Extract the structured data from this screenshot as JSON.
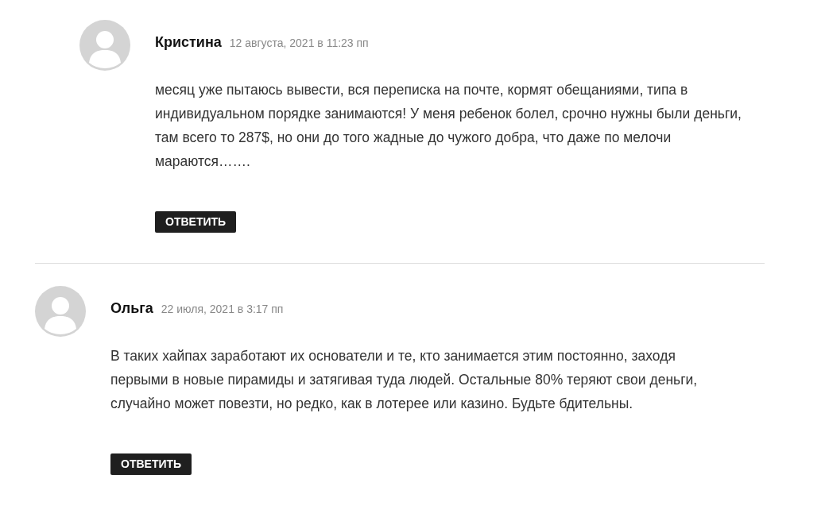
{
  "comments": [
    {
      "kind": "reply",
      "author": "Кристина",
      "date": "12 августа, 2021 в 11:23 пп",
      "text": "месяц уже пытаюсь вывести, вся переписка на почте, кормят обещаниями, типа в индивидуальном порядке занимаются! У меня ребенок болел, срочно нужны были деньги, там всего то 287$, но они до того жадные до чужого добра, что даже по мелочи мараются…….",
      "reply_button": "ОТВЕТИТЬ"
    },
    {
      "kind": "comment",
      "author": "Ольга",
      "date": "22 июля, 2021 в 3:17 пп",
      "text": "В таких хайпах заработают их основатели и те, кто занимается этим постоянно, заходя первыми в новые пирамиды и затягивая туда людей. Остальные 80% теряют свои деньги, случайно может повезти, но редко, как в лотерее или казино. Будьте бдительны.",
      "reply_button": "ОТВЕТИТЬ"
    }
  ]
}
